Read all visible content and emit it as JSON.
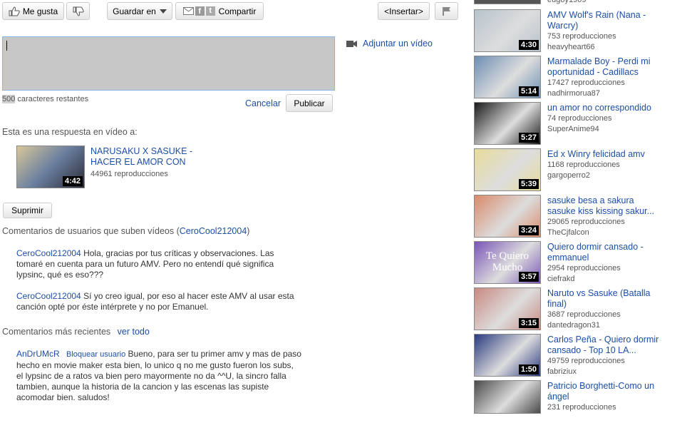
{
  "toolbar": {
    "like_label": "Me gusta",
    "save_label": "Guardar en",
    "share_label": "Compartir",
    "embed_label": "<Insertar>"
  },
  "attach_video_label": "Adjuntar un vídeo",
  "comment_box": {
    "remaining_count": "500",
    "remaining_label": "caracteres restantes",
    "cancel_label": "Cancelar",
    "publish_label": "Publicar"
  },
  "response": {
    "heading": "Esta es una respuesta en vídeo a:",
    "title_line1": "NARUSAKU X SASUKE -",
    "title_line2": "HACER EL AMOR CON",
    "views": "44961 reproducciones",
    "duration": "4:42",
    "remove_label": "Suprimir"
  },
  "uploader_comments": {
    "heading_prefix": "Comentarios de usuarios que suben vídeos (",
    "heading_user": "CeroCool212004",
    "heading_suffix": ")",
    "items": [
      {
        "user": "CeroCool212004",
        "text": " Hola, gracias por tus críticas y observaciones. Las tomaré en cuenta para un futuro AMV. Pero no entendí qué significa lypsinc, qué es eso???"
      },
      {
        "user": "CeroCool212004",
        "text": " Sí yo creo igual, por eso al hacer este AMV al usar esta canción opté por éste intérprete y no por Emanuel."
      }
    ]
  },
  "recent_comments": {
    "heading": "Comentarios más recientes",
    "see_all": "ver todo",
    "items": [
      {
        "user": "AnDrUMcR",
        "block": "Bloquear usuario",
        "text": " Bueno, para ser tu primer amv y mas de paso hecho en movie maker esta bien, lo unico q no me gusto fueron los subs, el lypsinc de a ratos va bien pero mayormente no da ^^U, la sincro falla tambien, aunque la historia de la cancion y las escenas las supiste acomodar bien. saludos!"
      }
    ]
  },
  "sidebar": {
    "top_partial_user": "eugoy1909",
    "videos": [
      {
        "title1": "AMV Wolf's Rain (Nana -",
        "title2": "Warcry)",
        "views": "753 reproducciones",
        "user": "heavyheart66",
        "duration": "4:30",
        "color": "#b7c3cc"
      },
      {
        "title1": "Marmalade Boy - Perdi mi",
        "title2": "oportunidad - Cadillacs",
        "views": "17427 reproducciones",
        "user": "nadhirmorua87",
        "duration": "5:14",
        "color": "#6d8fb3"
      },
      {
        "title1": "un amor no correspondido",
        "title2": "",
        "views": "74 reproducciones",
        "user": "SuperAnime94",
        "duration": "5:27",
        "color": "#1a1a1a"
      },
      {
        "title1": "Ed x Winry felicidad amv",
        "title2": "",
        "views": "1168 reproducciones",
        "user": "gargoperro2",
        "duration": "5:39",
        "color": "#e8dc9a"
      },
      {
        "title1": "sasuke besa a sakura",
        "title2": "sasuke kiss kissing sakur...",
        "views": "29065 reproducciones",
        "user": "TheCjfalcon",
        "duration": "3:24",
        "color": "#d98a6a"
      },
      {
        "title1": "Quiero dormir cansado -",
        "title2": "emmanuel",
        "views": "2954 reproducciones",
        "user": "ciefrakd",
        "duration": "3:57",
        "color": "#7a55b8",
        "thumb_text": "Te Quiero Mucho"
      },
      {
        "title1": "Naruto vs Sasuke (Batalla",
        "title2": "final)",
        "views": "3687 reproducciones",
        "user": "dantedragon31",
        "duration": "3:15",
        "color": "#c98a80"
      },
      {
        "title1": "Carlos Peña - Quiero dormir",
        "title2": "cansado - Top 10 LA...",
        "views": "49759 reproducciones",
        "user": "fabriziux",
        "duration": "1:50",
        "color": "#2a3a80"
      },
      {
        "title1": "Patricio Borghetti-Como un",
        "title2": "ángel",
        "views": "231 reproducciones",
        "user": "",
        "duration": "",
        "color": "#4a4a4a"
      }
    ]
  }
}
